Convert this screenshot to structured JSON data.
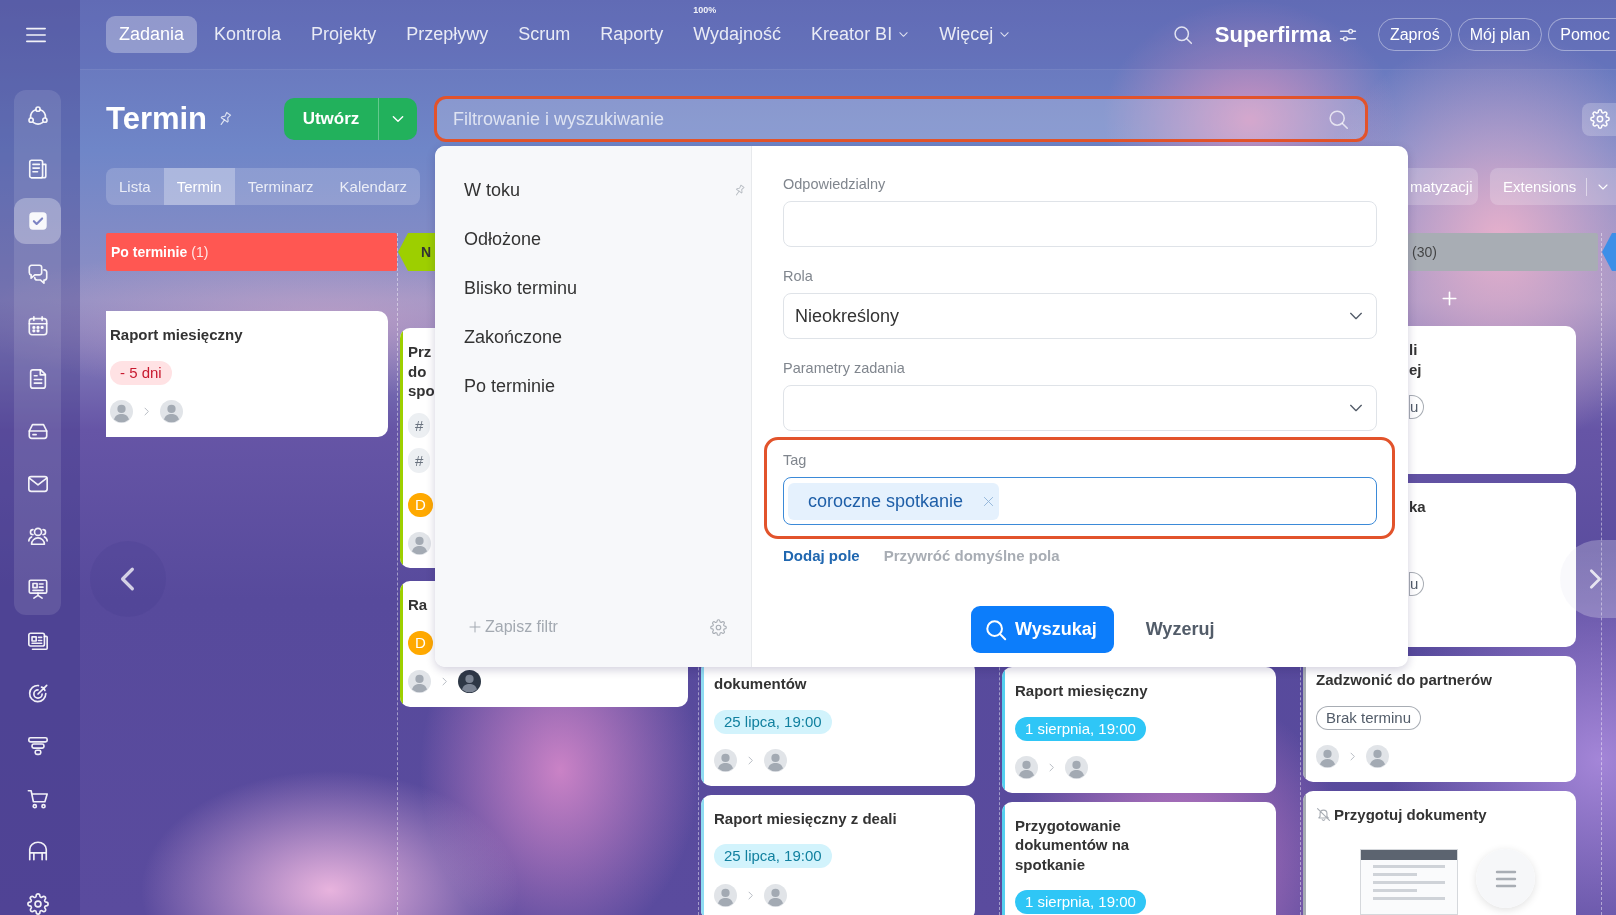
{
  "top_bar": {
    "nav": [
      {
        "label": "Zadania",
        "selected": true
      },
      {
        "label": "Kontrola",
        "selected": false
      },
      {
        "label": "Projekty",
        "selected": false
      },
      {
        "label": "Przepływy",
        "selected": false
      },
      {
        "label": "Scrum",
        "selected": false
      },
      {
        "label": "Raporty",
        "selected": false
      },
      {
        "label": "Wydajność",
        "selected": false,
        "badge": "100%"
      },
      {
        "label": "Kreator BI",
        "selected": false,
        "dropdown": true
      },
      {
        "label": "Więcej",
        "selected": false,
        "dropdown": true
      }
    ],
    "company": "Superfirma",
    "buttons": [
      "Zaproś",
      "Mój plan",
      "Pomoc"
    ]
  },
  "sidebar": {
    "groups": [
      {
        "framed": true,
        "items": [
          {
            "selected": false
          },
          {
            "selected": false
          },
          {
            "selected": true
          },
          {
            "selected": false
          },
          {
            "selected": false
          },
          {
            "selected": false
          },
          {
            "selected": false
          },
          {
            "selected": false
          },
          {
            "selected": false
          },
          {
            "selected": false
          }
        ]
      },
      {
        "items": [
          {
            "selected": false
          },
          {
            "selected": false
          },
          {
            "selected": false
          },
          {
            "selected": false
          },
          {
            "selected": false
          },
          {
            "selected": false
          }
        ]
      }
    ]
  },
  "page": {
    "title": "Termin",
    "create_button": "Utwórz",
    "search": {
      "placeholder": "Filtrowanie i wyszukiwanie",
      "highlighted": true
    },
    "view_tabs": [
      {
        "label": "Lista",
        "selected": false
      },
      {
        "label": "Termin",
        "selected": true
      },
      {
        "label": "Terminarz",
        "selected": false
      },
      {
        "label": "Kalendarz",
        "selected": false
      }
    ],
    "toolbar_buttons": [
      {
        "label": "matyzacji"
      },
      {
        "label": "Extensions",
        "dropdown": true
      }
    ]
  },
  "board": {
    "columns": [
      {
        "title": "Po terminie",
        "count": "(1)",
        "color": "#ff5752",
        "cards": [
          {
            "title": "Raport miesięczny",
            "deadline": {
              "text": "- 5 dni",
              "kind": "overdue"
            },
            "avatars": [
              {
                "dark": false
              },
              {
                "dark": false
              }
            ]
          }
        ]
      },
      {
        "title": "N",
        "color": "#9dcf00",
        "striped": true,
        "cards": [
          {
            "title": "Prz do spo",
            "tags": [
              "#",
              "#"
            ],
            "deadline": {
              "text": "D",
              "kind": "soon"
            },
            "avatars": [
              {
                "dark": false
              }
            ]
          },
          {
            "title": "Ra",
            "deadline": {
              "text": "D",
              "kind": "soon"
            },
            "avatars": [
              {
                "dark": false
              },
              {
                "dark": true
              }
            ]
          }
        ]
      },
      {
        "color": "#8fdcf2",
        "striped": true,
        "cards": [
          {
            "title": "dokumentów",
            "deadline": {
              "text": "25 lipca, 19:00",
              "kind": "week"
            },
            "avatars": [
              {
                "dark": false
              },
              {
                "dark": false
              }
            ]
          },
          {
            "title": "Raport miesięczny z deali",
            "deadline": {
              "text": "25 lipca, 19:00",
              "kind": "week"
            },
            "avatars": [
              {
                "dark": false
              },
              {
                "dark": false
              }
            ]
          }
        ]
      },
      {
        "color": "#55d0f0",
        "striped": true,
        "cards": [
          {
            "title": "Raport miesięczny",
            "deadline": {
              "text": "1 sierpnia, 19:00",
              "kind": "later"
            },
            "avatars": [
              {
                "dark": false
              },
              {
                "dark": false
              }
            ]
          },
          {
            "title": "Przygotowanie dokumentów na spotkanie",
            "deadline": {
              "text": "1 sierpnia, 19:00",
              "kind": "later"
            }
          }
        ]
      },
      {
        "count": "(30)",
        "color": "#a8adb4",
        "striped": true,
        "add_button": true,
        "cards": [
          {
            "title": "li ej",
            "deadline": {
              "text": "u",
              "kind": "none"
            }
          },
          {
            "title": "ka",
            "deadline": {
              "text": "u",
              "kind": "none"
            }
          },
          {
            "title": "Zadzwonić do partnerów",
            "deadline": {
              "text": "Brak terminu",
              "kind": "none"
            },
            "avatars": [
              {
                "dark": false
              },
              {
                "dark": false
              }
            ]
          },
          {
            "title": "Przygotuj dokumenty",
            "muted": true,
            "attachment": true
          }
        ]
      },
      {
        "color": "#3d8fe8"
      }
    ]
  },
  "filter": {
    "presets": [
      {
        "label": "W toku",
        "pinned": true
      },
      {
        "label": "Odłożone",
        "pinned": false
      },
      {
        "label": "Blisko terminu",
        "pinned": false
      },
      {
        "label": "Zakończone",
        "pinned": false
      },
      {
        "label": "Po terminie",
        "pinned": false
      }
    ],
    "save_filter": "Zapisz filtr",
    "fields": [
      {
        "label": "Odpowiedzialny",
        "kind": "input",
        "highlighted": false
      },
      {
        "label": "Rola",
        "kind": "select",
        "value": "Nieokreślony",
        "highlighted": false
      },
      {
        "label": "Parametry zadania",
        "kind": "select",
        "highlighted": false
      },
      {
        "label": "Tag",
        "kind": "tags",
        "tags": [
          "coroczne spotkanie"
        ],
        "highlighted": true
      }
    ],
    "add_field": "Dodaj pole",
    "restore_fields": "Przywróć domyślne pola",
    "search_button": "Wyszukaj",
    "reset_button": "Wyzeruj"
  }
}
